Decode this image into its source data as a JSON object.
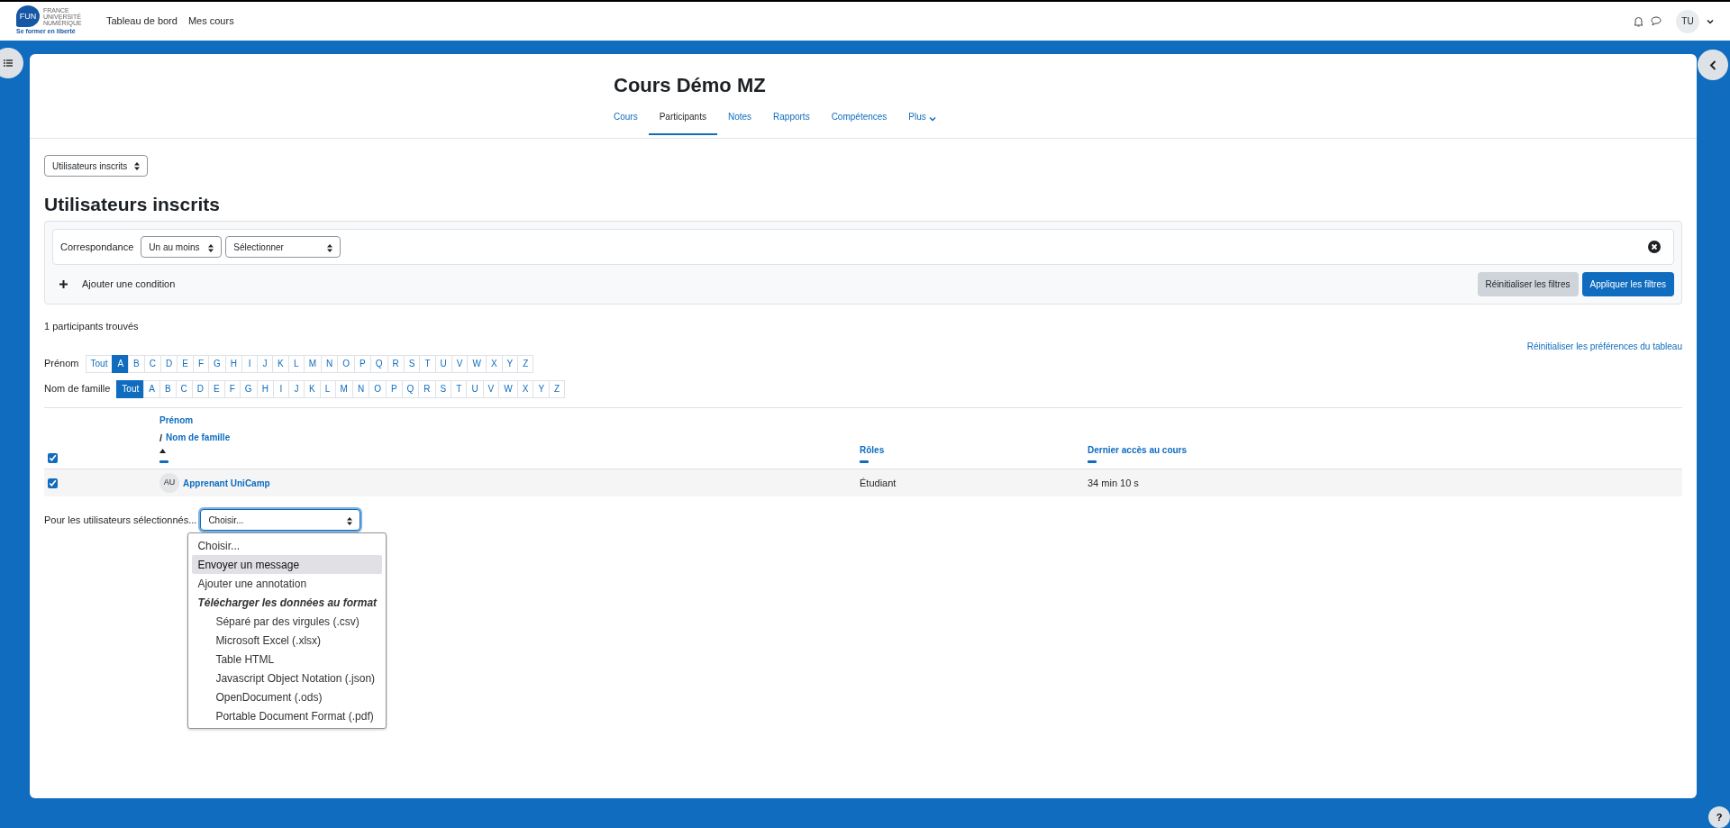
{
  "navbar": {
    "logo": {
      "mark": "FUN",
      "lines": [
        "FRANCE",
        "UNIVERSITÉ",
        "NUMÉRIQUE"
      ],
      "tagline": "Se former en liberté"
    },
    "links": [
      "Tableau de bord",
      "Mes cours"
    ],
    "user_initials": "TU"
  },
  "course": {
    "title": "Cours Démo MZ",
    "tabs": [
      {
        "label": "Cours",
        "selected": false,
        "has_menu": false
      },
      {
        "label": "Participants",
        "selected": true,
        "has_menu": false
      },
      {
        "label": "Notes",
        "selected": false,
        "has_menu": false
      },
      {
        "label": "Rapports",
        "selected": false,
        "has_menu": false
      },
      {
        "label": "Compétences",
        "selected": false,
        "has_menu": false
      },
      {
        "label": "Plus",
        "selected": false,
        "has_menu": true
      }
    ]
  },
  "help_label": "?",
  "page_select": "Utilisateurs inscrits",
  "heading": "Utilisateurs inscrits",
  "filter": {
    "match_label": "Correspondance",
    "match_value": "Un au moins",
    "field_value": "Sélectionner",
    "add_condition": "Ajouter une condition",
    "buttons": [
      {
        "label": "Réinitialiser les filtres",
        "kind": "secondary"
      },
      {
        "label": "Appliquer les filtres",
        "kind": "primary"
      }
    ]
  },
  "result_count": "1 participants trouvés",
  "reset_preferences": "Réinitialiser les préférences du tableau",
  "initials_bars": [
    {
      "label": "Prénom",
      "letters": [
        {
          "text": "Tout",
          "selected": false
        },
        {
          "text": "A",
          "selected": true
        },
        {
          "text": "B",
          "selected": false
        },
        {
          "text": "C",
          "selected": false
        },
        {
          "text": "D",
          "selected": false
        },
        {
          "text": "E",
          "selected": false
        },
        {
          "text": "F",
          "selected": false
        },
        {
          "text": "G",
          "selected": false
        },
        {
          "text": "H",
          "selected": false
        },
        {
          "text": "I",
          "selected": false
        },
        {
          "text": "J",
          "selected": false
        },
        {
          "text": "K",
          "selected": false
        },
        {
          "text": "L",
          "selected": false
        },
        {
          "text": "M",
          "selected": false
        },
        {
          "text": "N",
          "selected": false
        },
        {
          "text": "O",
          "selected": false
        },
        {
          "text": "P",
          "selected": false
        },
        {
          "text": "Q",
          "selected": false
        },
        {
          "text": "R",
          "selected": false
        },
        {
          "text": "S",
          "selected": false
        },
        {
          "text": "T",
          "selected": false
        },
        {
          "text": "U",
          "selected": false
        },
        {
          "text": "V",
          "selected": false
        },
        {
          "text": "W",
          "selected": false
        },
        {
          "text": "X",
          "selected": false
        },
        {
          "text": "Y",
          "selected": false
        },
        {
          "text": "Z",
          "selected": false
        }
      ]
    },
    {
      "label": "Nom de famille",
      "letters": [
        {
          "text": "Tout",
          "selected": true
        },
        {
          "text": "A",
          "selected": false
        },
        {
          "text": "B",
          "selected": false
        },
        {
          "text": "C",
          "selected": false
        },
        {
          "text": "D",
          "selected": false
        },
        {
          "text": "E",
          "selected": false
        },
        {
          "text": "F",
          "selected": false
        },
        {
          "text": "G",
          "selected": false
        },
        {
          "text": "H",
          "selected": false
        },
        {
          "text": "I",
          "selected": false
        },
        {
          "text": "J",
          "selected": false
        },
        {
          "text": "K",
          "selected": false
        },
        {
          "text": "L",
          "selected": false
        },
        {
          "text": "M",
          "selected": false
        },
        {
          "text": "N",
          "selected": false
        },
        {
          "text": "O",
          "selected": false
        },
        {
          "text": "P",
          "selected": false
        },
        {
          "text": "Q",
          "selected": false
        },
        {
          "text": "R",
          "selected": false
        },
        {
          "text": "S",
          "selected": false
        },
        {
          "text": "T",
          "selected": false
        },
        {
          "text": "U",
          "selected": false
        },
        {
          "text": "V",
          "selected": false
        },
        {
          "text": "W",
          "selected": false
        },
        {
          "text": "X",
          "selected": false
        },
        {
          "text": "Y",
          "selected": false
        },
        {
          "text": "Z",
          "selected": false
        }
      ]
    }
  ],
  "table": {
    "select_all_checked": true,
    "name_column": {
      "first": "Prénom",
      "separator": "/",
      "second": "Nom de famille"
    },
    "roles_column": "Rôles",
    "access_column": "Dernier accès au cours",
    "rows": [
      {
        "checked": true,
        "initials": "AU",
        "name": "Apprenant UniCamp",
        "role": "Étudiant",
        "last_access": "34 min 10 s"
      }
    ]
  },
  "bulk_action": {
    "label": "Pour les utilisateurs sélectionnés...",
    "value": "Choisir...",
    "options": [
      {
        "text": "Choisir...",
        "kind": "option",
        "highlighted": false
      },
      {
        "text": "Envoyer un message",
        "kind": "option",
        "highlighted": true
      },
      {
        "text": "Ajouter une annotation",
        "kind": "option",
        "highlighted": false
      },
      {
        "text": "Télécharger les données au format",
        "kind": "group",
        "highlighted": false
      },
      {
        "text": "Séparé par des virgules (.csv)",
        "kind": "suboption",
        "highlighted": false
      },
      {
        "text": "Microsoft Excel (.xlsx)",
        "kind": "suboption",
        "highlighted": false
      },
      {
        "text": "Table HTML",
        "kind": "suboption",
        "highlighted": false
      },
      {
        "text": "Javascript Object Notation (.json)",
        "kind": "suboption",
        "highlighted": false
      },
      {
        "text": "OpenDocument (.ods)",
        "kind": "suboption",
        "highlighted": false
      },
      {
        "text": "Portable Document Format (.pdf)",
        "kind": "suboption",
        "highlighted": false
      }
    ]
  }
}
